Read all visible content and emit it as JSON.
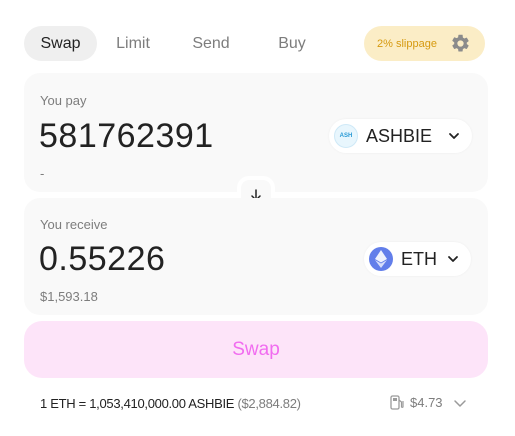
{
  "tabs": [
    {
      "label": "Swap",
      "active": true
    },
    {
      "label": "Limit",
      "active": false
    },
    {
      "label": "Send",
      "active": false
    },
    {
      "label": "Buy",
      "active": false
    }
  ],
  "slippage": {
    "label": "2% slippage",
    "icon": "gear-icon"
  },
  "pay": {
    "label": "You pay",
    "amount": "581762391",
    "usd": "-",
    "token": {
      "symbol": "ASHBIE",
      "icon_text": "ASH",
      "icon": "ashbie-token-icon"
    }
  },
  "switch": {
    "icon": "arrow-down-icon"
  },
  "receive": {
    "label": "You receive",
    "amount": "0.55226",
    "usd": "$1,593.18",
    "token": {
      "symbol": "ETH",
      "icon": "eth-token-icon"
    }
  },
  "swap_button": {
    "label": "Swap"
  },
  "rate": {
    "text": "1 ETH = 1,053,410,000.00 ASHBIE",
    "usd": "($2,884.82)"
  },
  "gas": {
    "icon": "gas-pump-icon",
    "value": "$4.73"
  },
  "colors": {
    "accent": "#f16cf0",
    "swap_bg": "#fde4f9",
    "slippage_bg": "#fbedc6",
    "slippage_text": "#d69a10",
    "eth": "#627eea"
  }
}
